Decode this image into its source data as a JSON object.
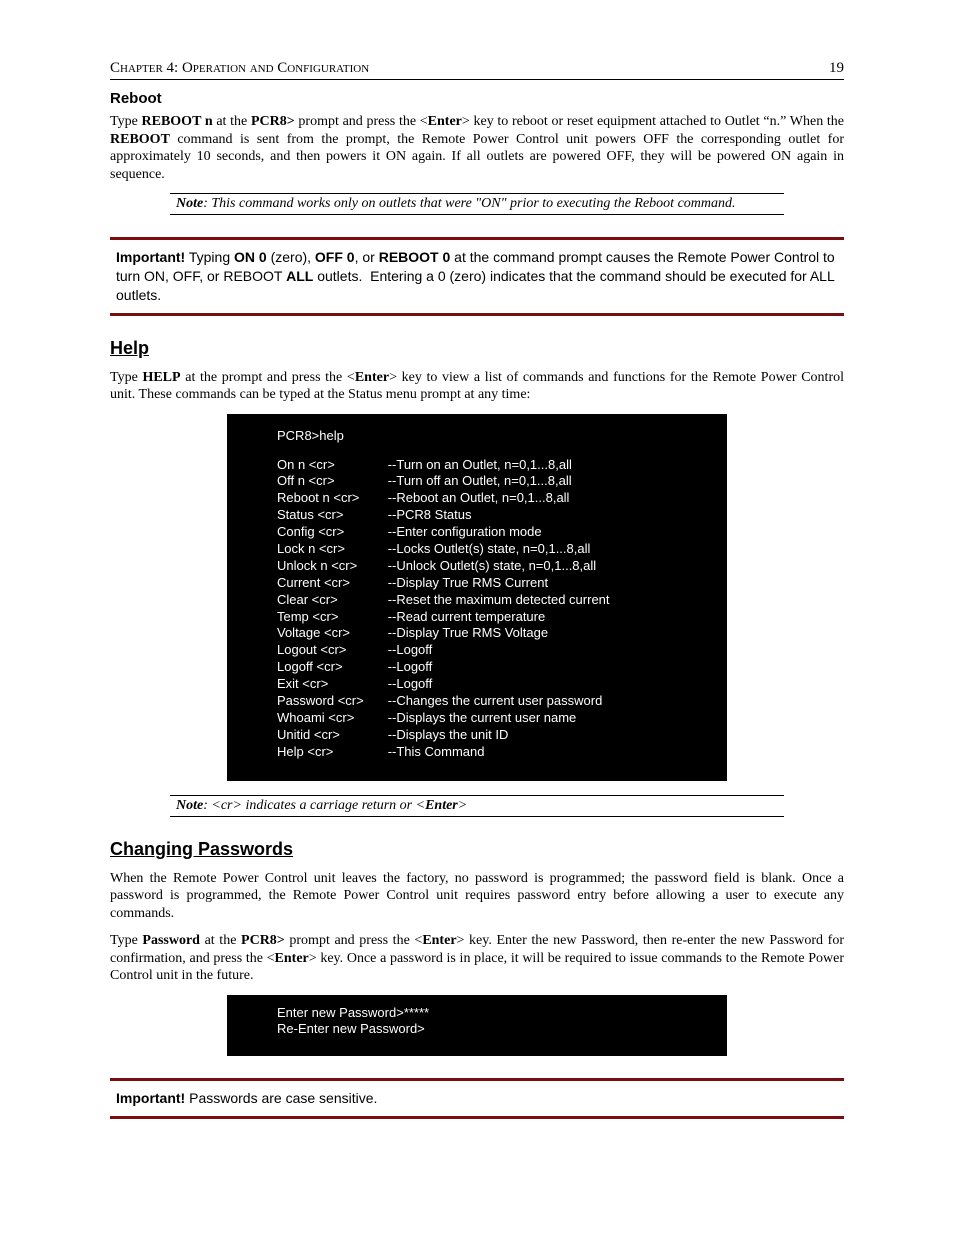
{
  "header": {
    "chapter": "Chapter 4: Operation and Configuration",
    "page_number": "19"
  },
  "reboot": {
    "heading": "Reboot",
    "para": "Type REBOOT n at the PCR8> prompt and press the <Enter> key to reboot or reset equipment attached to Outlet \"n.\" When the REBOOT command is sent from the prompt, the Remote Power Control unit powers OFF the corresponding outlet for approximately 10 seconds, and then powers it ON again. If all outlets are powered OFF, they will be powered ON again in sequence.",
    "note_label": "Note",
    "note": ": This command works only on outlets that were \"ON\" prior to executing the Reboot command.",
    "important_label": "Important!",
    "important": " Typing ON 0 (zero), OFF 0, or REBOOT 0 at the command prompt causes the Remote Power Control to turn ON, OFF, or REBOOT ALL outlets.  Entering a 0 (zero) indicates that the command should be executed for ALL outlets."
  },
  "help": {
    "heading": "Help",
    "para": "Type HELP at the prompt and press the <Enter> key to view a list of commands and functions for the Remote Power Control unit. These commands can be typed at the Status menu prompt at any time:",
    "prompt": "PCR8>help",
    "commands": [
      {
        "cmd": "On n <cr>",
        "desc": "--Turn on an Outlet, n=0,1...8,all"
      },
      {
        "cmd": "Off n <cr>",
        "desc": "--Turn off an Outlet, n=0,1...8,all"
      },
      {
        "cmd": "Reboot n <cr>",
        "desc": "--Reboot an Outlet, n=0,1...8,all"
      },
      {
        "cmd": "Status <cr>",
        "desc": "--PCR8 Status"
      },
      {
        "cmd": "Config <cr>",
        "desc": "--Enter configuration mode"
      },
      {
        "cmd": "Lock n <cr>",
        "desc": "--Locks Outlet(s) state, n=0,1...8,all"
      },
      {
        "cmd": "Unlock n <cr>",
        "desc": "--Unlock Outlet(s) state, n=0,1...8,all"
      },
      {
        "cmd": "Current <cr>",
        "desc": "--Display True RMS Current"
      },
      {
        "cmd": "Clear <cr>",
        "desc": "--Reset the maximum detected current"
      },
      {
        "cmd": "Temp <cr>",
        "desc": "--Read current temperature"
      },
      {
        "cmd": "Voltage <cr>",
        "desc": "--Display True RMS Voltage"
      },
      {
        "cmd": "Logout <cr>",
        "desc": "--Logoff"
      },
      {
        "cmd": "Logoff <cr>",
        "desc": "--Logoff"
      },
      {
        "cmd": "Exit <cr>",
        "desc": "--Logoff"
      },
      {
        "cmd": "Password <cr>",
        "desc": "--Changes the current user password"
      },
      {
        "cmd": "Whoami <cr>",
        "desc": "--Displays the current user name"
      },
      {
        "cmd": "Unitid <cr>",
        "desc": "--Displays the unit ID"
      },
      {
        "cmd": "Help <cr>",
        "desc": "--This Command"
      }
    ],
    "note_label": "Note",
    "note": ": <cr> indicates a carriage return or <Enter>"
  },
  "passwords": {
    "heading": "Changing Passwords",
    "para1": "When the Remote Power Control unit leaves the factory, no password is programmed; the password field is blank. Once a password is programmed, the Remote Power Control unit requires password entry before allowing a user to execute any commands.",
    "para2": "Type Password at the PCR8> prompt and press the <Enter> key. Enter the new Password, then re-enter the new Password for confirmation, and press the <Enter> key. Once a password is in place, it will be required to issue commands to the Remote Power Control unit in the future.",
    "term_line1": "Enter new Password>*****",
    "term_line2": "Re-Enter new Password>",
    "important_label": "Important!",
    "important": " Passwords are case sensitive."
  }
}
